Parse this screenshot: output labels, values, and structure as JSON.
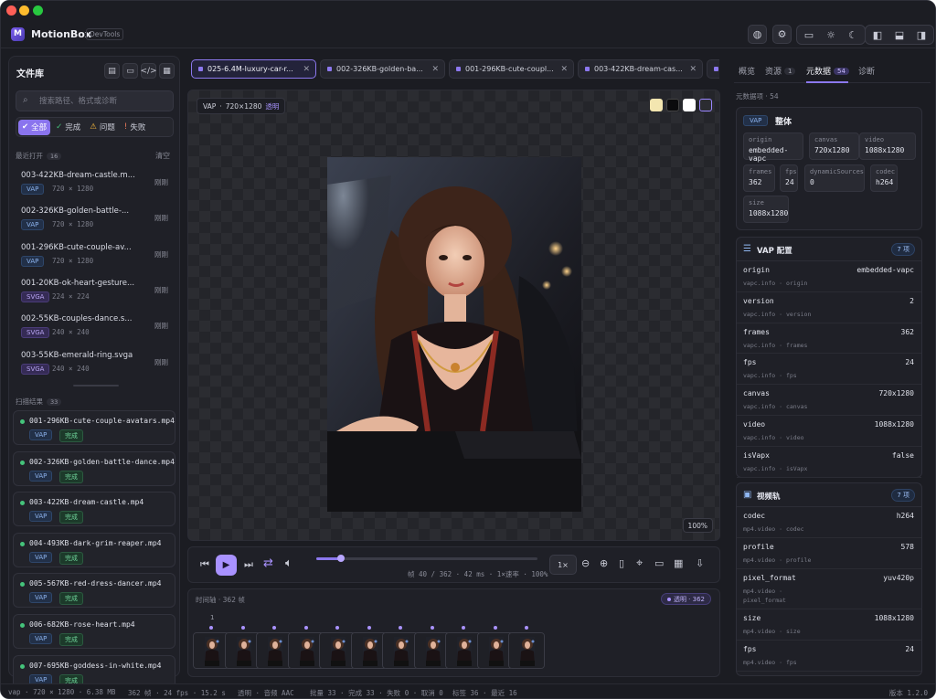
{
  "app": {
    "name": "MotionBox",
    "tag": "DevTools",
    "version": "版本 1.2.0"
  },
  "toolbar": {
    "icons": [
      "globe-icon",
      "settings-icon",
      "monitor-icon",
      "sun-icon",
      "moon-icon",
      "layout-left-icon",
      "layout-bottom-icon",
      "layout-right-icon"
    ]
  },
  "library": {
    "title": "文件库",
    "search_placeholder": "搜索路径、格式或诊断",
    "filters": [
      {
        "label": "全部",
        "icon": "✔"
      },
      {
        "label": "完成",
        "icon": "✓"
      },
      {
        "label": "问题",
        "icon": "⚠"
      },
      {
        "label": "失败",
        "icon": "!"
      }
    ],
    "recent_label": "最近打开",
    "recent_count": "16",
    "clear_label": "清空",
    "recent": [
      {
        "name": "003-422KB-dream-castle.m...",
        "format": "VAP",
        "dims": "720 × 1280",
        "time": "刚刚"
      },
      {
        "name": "002-326KB-golden-battle-...",
        "format": "VAP",
        "dims": "720 × 1280",
        "time": "刚刚"
      },
      {
        "name": "001-296KB-cute-couple-av...",
        "format": "VAP",
        "dims": "720 × 1280",
        "time": "刚刚"
      },
      {
        "name": "001-20KB-ok-heart-gesture...",
        "format": "SVGA",
        "dims": "224 × 224",
        "time": "刚刚"
      },
      {
        "name": "002-55KB-couples-dance.s...",
        "format": "SVGA",
        "dims": "240 × 240",
        "time": "刚刚"
      },
      {
        "name": "003-55KB-emerald-ring.svga",
        "format": "SVGA",
        "dims": "240 × 240",
        "time": "刚刚"
      }
    ],
    "scan_label": "扫描结果",
    "scan_count": "33",
    "scan": [
      {
        "name": "001-296KB-cute-couple-avatars.mp4",
        "format": "VAP",
        "status": "完成"
      },
      {
        "name": "002-326KB-golden-battle-dance.mp4",
        "format": "VAP",
        "status": "完成"
      },
      {
        "name": "003-422KB-dream-castle.mp4",
        "format": "VAP",
        "status": "完成"
      },
      {
        "name": "004-493KB-dark-grim-reaper.mp4",
        "format": "VAP",
        "status": "完成"
      },
      {
        "name": "005-567KB-red-dress-dancer.mp4",
        "format": "VAP",
        "status": "完成"
      },
      {
        "name": "006-682KB-rose-heart.mp4",
        "format": "VAP",
        "status": "完成"
      },
      {
        "name": "007-695KB-goddess-in-white.mp4",
        "format": "VAP",
        "status": "完成"
      }
    ]
  },
  "tabs": [
    {
      "label": "025-6.4M-luxury-car-r...",
      "active": true
    },
    {
      "label": "002-326KB-golden-ba...",
      "active": false
    },
    {
      "label": "001-296KB-cute-coupl...",
      "active": false
    },
    {
      "label": "003-422KB-dream-cas...",
      "active": false
    }
  ],
  "stage": {
    "format": "VAP",
    "dims": "720×1280",
    "transparent": "透明",
    "zoom": "100%"
  },
  "player": {
    "progress": 0.11,
    "info": "帧 40 / 362 · 42 ms · 1×速率 · 100%",
    "speed": "1×"
  },
  "timeline": {
    "label": "时间轴 · 362 帧",
    "tag": "透明 · 362",
    "marker": "1"
  },
  "inspector": {
    "tabs": [
      {
        "label": "概览"
      },
      {
        "label": "资源",
        "count": "1"
      },
      {
        "label": "元数据",
        "count": "54"
      },
      {
        "label": "诊断"
      }
    ],
    "meta_header": "元数据项 · 54",
    "overall": {
      "badge": "VAP",
      "title": "整体",
      "fields": [
        {
          "k": "origin",
          "v": "embedded-vapc"
        },
        {
          "k": "canvas",
          "v": "720x1280"
        },
        {
          "k": "video",
          "v": "1088x1280"
        },
        {
          "k": "frames",
          "v": "362"
        },
        {
          "k": "fps",
          "v": "24"
        },
        {
          "k": "dynamicSources",
          "v": "0"
        },
        {
          "k": "codec",
          "v": "h264"
        },
        {
          "k": "size",
          "v": "1088x1280"
        }
      ]
    },
    "vap_config": {
      "title": "VAP 配置",
      "count": "7 项",
      "rows": [
        {
          "k": "origin",
          "p": "vapc.info · origin",
          "v": "embedded-vapc"
        },
        {
          "k": "version",
          "p": "vapc.info · version",
          "v": "2"
        },
        {
          "k": "frames",
          "p": "vapc.info · frames",
          "v": "362"
        },
        {
          "k": "fps",
          "p": "vapc.info · fps",
          "v": "24"
        },
        {
          "k": "canvas",
          "p": "vapc.info · canvas",
          "v": "720x1280"
        },
        {
          "k": "video",
          "p": "vapc.info · video",
          "v": "1088x1280"
        },
        {
          "k": "isVapx",
          "p": "vapc.info · isVapx",
          "v": "false"
        }
      ]
    },
    "video_track": {
      "title": "视频轨",
      "count": "7 项",
      "rows": [
        {
          "k": "codec",
          "p": "mp4.video · codec",
          "v": "h264"
        },
        {
          "k": "profile",
          "p": "mp4.video · profile",
          "v": "578"
        },
        {
          "k": "pixel_format",
          "p": "mp4.video · pixel_format",
          "v": "yuv420p"
        },
        {
          "k": "size",
          "p": "mp4.video · size",
          "v": "1088x1280"
        },
        {
          "k": "fps",
          "p": "mp4.video · fps",
          "v": "24"
        }
      ]
    }
  },
  "status": {
    "s1": "vap · 720 × 1280 · 6.38 MB",
    "s2": "362 帧 · 24 fps · 15.2 s",
    "s3": "透明 · 音频 AAC",
    "s4": "批量 33 · 完成 33 · 失败 0 · 取消 0",
    "s5": "标签 36 · 最近 16"
  },
  "colors": {
    "accent": "#8c78ee",
    "success": "#45c47b",
    "bg": "#1b1c22"
  }
}
